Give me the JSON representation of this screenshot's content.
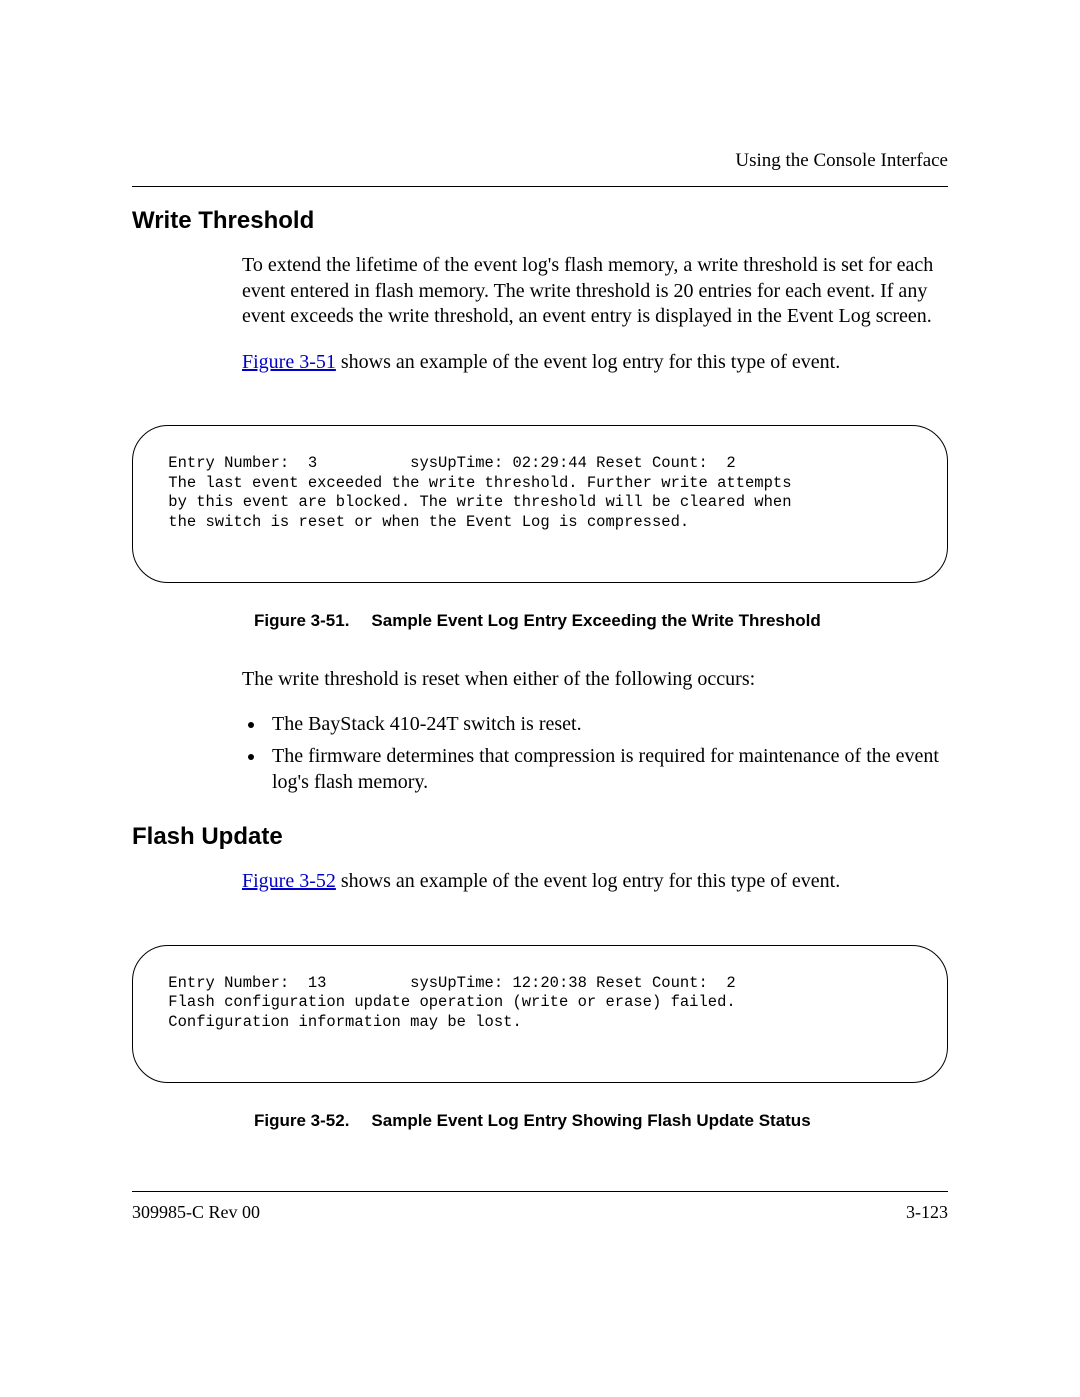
{
  "header": {
    "running": "Using the Console Interface"
  },
  "sections": {
    "write_threshold": {
      "heading": "Write Threshold",
      "p1": "To extend the lifetime of the event log's flash memory, a write threshold is set for each event entered in flash memory. The write threshold is 20 entries for each event. If any event exceeds the write threshold, an event entry is displayed in the Event Log screen.",
      "figref1": "Figure 3-51",
      "p2_after": " shows an example of the event log entry for this type of event.",
      "log1": " Entry Number:  3          sysUpTime: 02:29:44 Reset Count:  2\n The last event exceeded the write threshold. Further write attempts\n by this event are blocked. The write threshold will be cleared when\n the switch is reset or when the Event Log is compressed.",
      "caption1_a": "Figure 3-51.",
      "caption1_b": "Sample Event Log Entry Exceeding the Write Threshold",
      "p3": "The write threshold is reset when either of the following occurs:",
      "bullets": [
        "The BayStack 410-24T switch is reset.",
        "The firmware determines that compression is required for maintenance of the event log's flash memory."
      ]
    },
    "flash_update": {
      "heading": "Flash Update",
      "figref2": "Figure 3-52",
      "p1_after": " shows an example of the event log entry for this type of event.",
      "log2": " Entry Number:  13         sysUpTime: 12:20:38 Reset Count:  2\n Flash configuration update operation (write or erase) failed.\n Configuration information may be lost.",
      "caption2_a": "Figure 3-52.",
      "caption2_b": "Sample Event Log Entry Showing Flash Update Status"
    }
  },
  "footer": {
    "left": "309985-C Rev 00",
    "right": "3-123"
  }
}
